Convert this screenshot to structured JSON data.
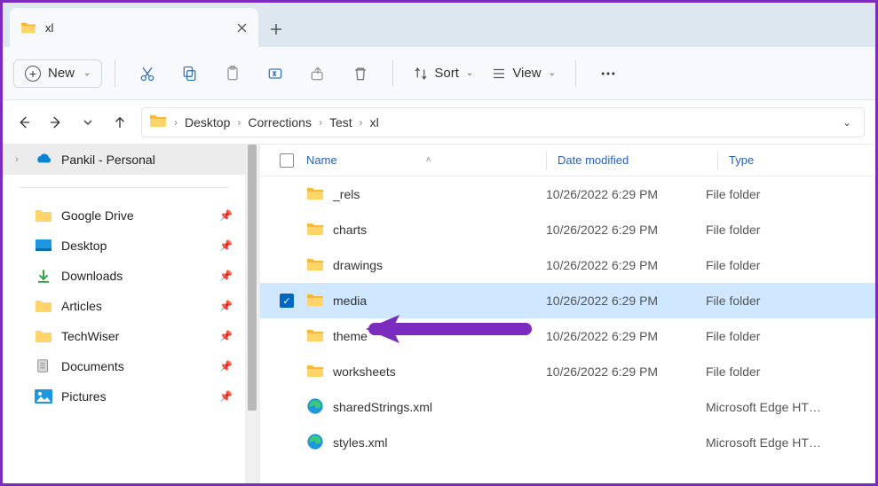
{
  "tab": {
    "title": "xl"
  },
  "toolbar": {
    "new_label": "New",
    "sort_label": "Sort",
    "view_label": "View"
  },
  "breadcrumbs": [
    "Desktop",
    "Corrections",
    "Test",
    "xl"
  ],
  "sidebar": {
    "top": {
      "label": "Pankil - Personal"
    },
    "items": [
      {
        "label": "Google Drive",
        "icon": "folder-yellow"
      },
      {
        "label": "Desktop",
        "icon": "desktop"
      },
      {
        "label": "Downloads",
        "icon": "downloads"
      },
      {
        "label": "Articles",
        "icon": "folder-yellow"
      },
      {
        "label": "TechWiser",
        "icon": "folder-yellow"
      },
      {
        "label": "Documents",
        "icon": "documents"
      },
      {
        "label": "Pictures",
        "icon": "pictures"
      }
    ]
  },
  "columns": {
    "name": "Name",
    "modified": "Date modified",
    "type": "Type"
  },
  "files": [
    {
      "name": "_rels",
      "modified": "10/26/2022 6:29 PM",
      "type": "File folder",
      "icon": "folder",
      "selected": false
    },
    {
      "name": "charts",
      "modified": "10/26/2022 6:29 PM",
      "type": "File folder",
      "icon": "folder",
      "selected": false
    },
    {
      "name": "drawings",
      "modified": "10/26/2022 6:29 PM",
      "type": "File folder",
      "icon": "folder",
      "selected": false
    },
    {
      "name": "media",
      "modified": "10/26/2022 6:29 PM",
      "type": "File folder",
      "icon": "folder",
      "selected": true
    },
    {
      "name": "theme",
      "modified": "10/26/2022 6:29 PM",
      "type": "File folder",
      "icon": "folder",
      "selected": false
    },
    {
      "name": "worksheets",
      "modified": "10/26/2022 6:29 PM",
      "type": "File folder",
      "icon": "folder",
      "selected": false
    },
    {
      "name": "sharedStrings.xml",
      "modified": "",
      "type": "Microsoft Edge HT…",
      "icon": "edge",
      "selected": false
    },
    {
      "name": "styles.xml",
      "modified": "",
      "type": "Microsoft Edge HT…",
      "icon": "edge",
      "selected": false
    }
  ],
  "annotation": {
    "color": "#7b2cbf"
  }
}
